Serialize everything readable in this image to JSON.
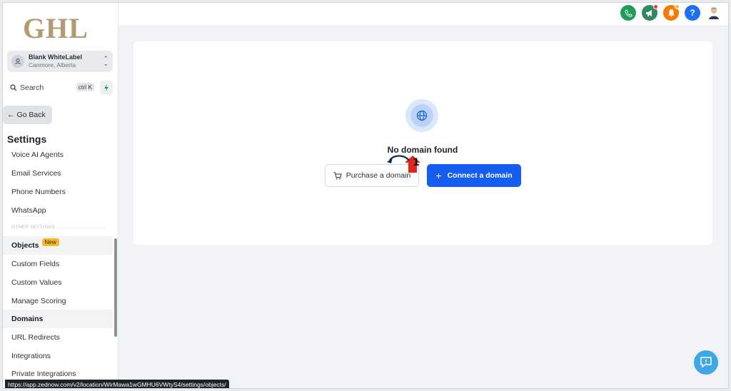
{
  "app": {
    "logo_text": "GHL"
  },
  "account": {
    "name": "Blank WhiteLabel",
    "location": "Canmore, Alberta"
  },
  "search": {
    "label": "Search",
    "shortcut": "ctrl K"
  },
  "nav": {
    "back_label": "Go Back",
    "settings_title": "Settings",
    "items_top": [
      "Voice AI Agents",
      "Email Services",
      "Phone Numbers",
      "WhatsApp"
    ],
    "section_label": "OTHER SETTINGS",
    "items_other": [
      {
        "label": "Objects",
        "badge": "New"
      },
      {
        "label": "Custom Fields"
      },
      {
        "label": "Custom Values"
      },
      {
        "label": "Manage Scoring"
      },
      {
        "label": "Domains"
      },
      {
        "label": "URL Redirects"
      },
      {
        "label": "Integrations"
      },
      {
        "label": "Private Integrations"
      }
    ]
  },
  "topbar": {
    "icons": [
      "phone-icon",
      "megaphone-icon",
      "bell-icon",
      "help-icon",
      "user-avatar"
    ],
    "colors": {
      "phone": "#1e9e5a",
      "megaphone": "#2f8a62",
      "bell": "#f57c00",
      "help": "#1e6ff1"
    }
  },
  "main": {
    "empty_title": "No domain found",
    "purchase_label": "Purchase a domain",
    "connect_label": "Connect a domain",
    "step_number": "1"
  },
  "status_url": "https://app.zednow.com/v2/location/WirMawa1wGMHU6VWtyS4/settings/objects/",
  "colors": {
    "primary": "#155eef",
    "badge": "#f5b92e",
    "brand": "#b39a71"
  }
}
